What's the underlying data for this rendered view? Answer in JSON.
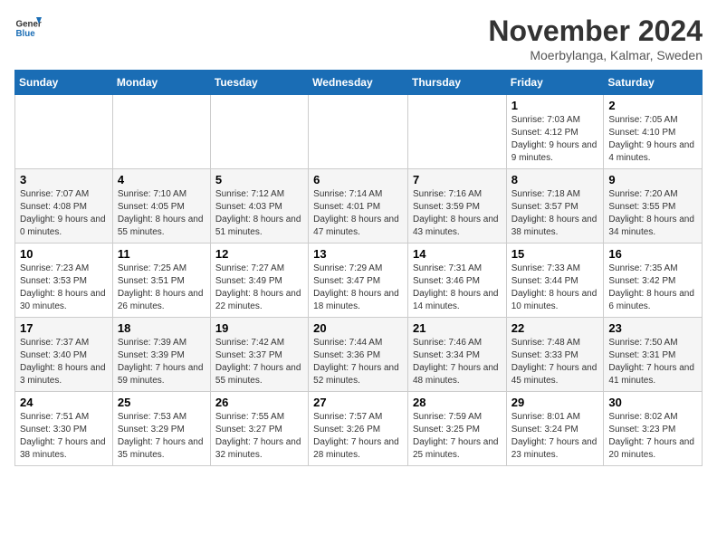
{
  "logo": {
    "text_general": "General",
    "text_blue": "Blue"
  },
  "title": {
    "month_year": "November 2024",
    "location": "Moerbylanga, Kalmar, Sweden"
  },
  "headers": [
    "Sunday",
    "Monday",
    "Tuesday",
    "Wednesday",
    "Thursday",
    "Friday",
    "Saturday"
  ],
  "weeks": [
    [
      {
        "day": "",
        "info": ""
      },
      {
        "day": "",
        "info": ""
      },
      {
        "day": "",
        "info": ""
      },
      {
        "day": "",
        "info": ""
      },
      {
        "day": "",
        "info": ""
      },
      {
        "day": "1",
        "info": "Sunrise: 7:03 AM\nSunset: 4:12 PM\nDaylight: 9 hours and 9 minutes."
      },
      {
        "day": "2",
        "info": "Sunrise: 7:05 AM\nSunset: 4:10 PM\nDaylight: 9 hours and 4 minutes."
      }
    ],
    [
      {
        "day": "3",
        "info": "Sunrise: 7:07 AM\nSunset: 4:08 PM\nDaylight: 9 hours and 0 minutes."
      },
      {
        "day": "4",
        "info": "Sunrise: 7:10 AM\nSunset: 4:05 PM\nDaylight: 8 hours and 55 minutes."
      },
      {
        "day": "5",
        "info": "Sunrise: 7:12 AM\nSunset: 4:03 PM\nDaylight: 8 hours and 51 minutes."
      },
      {
        "day": "6",
        "info": "Sunrise: 7:14 AM\nSunset: 4:01 PM\nDaylight: 8 hours and 47 minutes."
      },
      {
        "day": "7",
        "info": "Sunrise: 7:16 AM\nSunset: 3:59 PM\nDaylight: 8 hours and 43 minutes."
      },
      {
        "day": "8",
        "info": "Sunrise: 7:18 AM\nSunset: 3:57 PM\nDaylight: 8 hours and 38 minutes."
      },
      {
        "day": "9",
        "info": "Sunrise: 7:20 AM\nSunset: 3:55 PM\nDaylight: 8 hours and 34 minutes."
      }
    ],
    [
      {
        "day": "10",
        "info": "Sunrise: 7:23 AM\nSunset: 3:53 PM\nDaylight: 8 hours and 30 minutes."
      },
      {
        "day": "11",
        "info": "Sunrise: 7:25 AM\nSunset: 3:51 PM\nDaylight: 8 hours and 26 minutes."
      },
      {
        "day": "12",
        "info": "Sunrise: 7:27 AM\nSunset: 3:49 PM\nDaylight: 8 hours and 22 minutes."
      },
      {
        "day": "13",
        "info": "Sunrise: 7:29 AM\nSunset: 3:47 PM\nDaylight: 8 hours and 18 minutes."
      },
      {
        "day": "14",
        "info": "Sunrise: 7:31 AM\nSunset: 3:46 PM\nDaylight: 8 hours and 14 minutes."
      },
      {
        "day": "15",
        "info": "Sunrise: 7:33 AM\nSunset: 3:44 PM\nDaylight: 8 hours and 10 minutes."
      },
      {
        "day": "16",
        "info": "Sunrise: 7:35 AM\nSunset: 3:42 PM\nDaylight: 8 hours and 6 minutes."
      }
    ],
    [
      {
        "day": "17",
        "info": "Sunrise: 7:37 AM\nSunset: 3:40 PM\nDaylight: 8 hours and 3 minutes."
      },
      {
        "day": "18",
        "info": "Sunrise: 7:39 AM\nSunset: 3:39 PM\nDaylight: 7 hours and 59 minutes."
      },
      {
        "day": "19",
        "info": "Sunrise: 7:42 AM\nSunset: 3:37 PM\nDaylight: 7 hours and 55 minutes."
      },
      {
        "day": "20",
        "info": "Sunrise: 7:44 AM\nSunset: 3:36 PM\nDaylight: 7 hours and 52 minutes."
      },
      {
        "day": "21",
        "info": "Sunrise: 7:46 AM\nSunset: 3:34 PM\nDaylight: 7 hours and 48 minutes."
      },
      {
        "day": "22",
        "info": "Sunrise: 7:48 AM\nSunset: 3:33 PM\nDaylight: 7 hours and 45 minutes."
      },
      {
        "day": "23",
        "info": "Sunrise: 7:50 AM\nSunset: 3:31 PM\nDaylight: 7 hours and 41 minutes."
      }
    ],
    [
      {
        "day": "24",
        "info": "Sunrise: 7:51 AM\nSunset: 3:30 PM\nDaylight: 7 hours and 38 minutes."
      },
      {
        "day": "25",
        "info": "Sunrise: 7:53 AM\nSunset: 3:29 PM\nDaylight: 7 hours and 35 minutes."
      },
      {
        "day": "26",
        "info": "Sunrise: 7:55 AM\nSunset: 3:27 PM\nDaylight: 7 hours and 32 minutes."
      },
      {
        "day": "27",
        "info": "Sunrise: 7:57 AM\nSunset: 3:26 PM\nDaylight: 7 hours and 28 minutes."
      },
      {
        "day": "28",
        "info": "Sunrise: 7:59 AM\nSunset: 3:25 PM\nDaylight: 7 hours and 25 minutes."
      },
      {
        "day": "29",
        "info": "Sunrise: 8:01 AM\nSunset: 3:24 PM\nDaylight: 7 hours and 23 minutes."
      },
      {
        "day": "30",
        "info": "Sunrise: 8:02 AM\nSunset: 3:23 PM\nDaylight: 7 hours and 20 minutes."
      }
    ]
  ]
}
